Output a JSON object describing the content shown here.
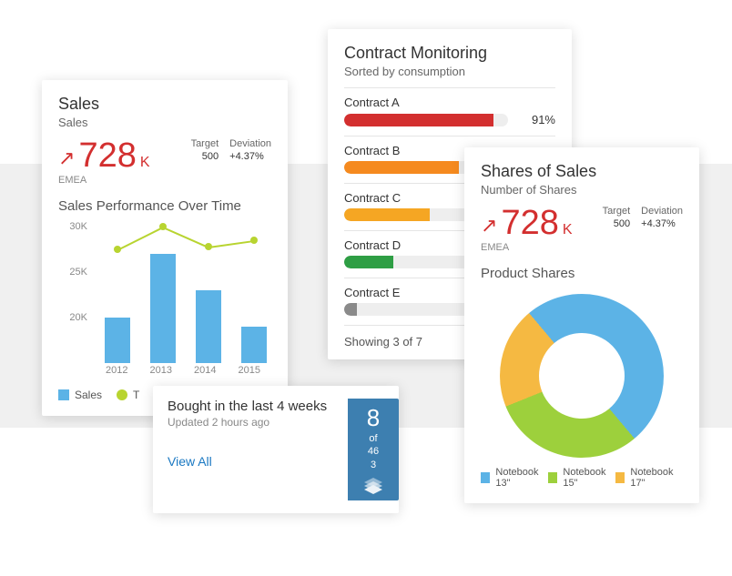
{
  "sales": {
    "title": "Sales",
    "subtitle": "Sales",
    "kpi": {
      "arrow": "↗",
      "value": "728",
      "unit": "K"
    },
    "target_label": "Target",
    "deviation_label": "Deviation",
    "target_value": "500",
    "deviation_value": "+4.37%",
    "region": "EMEA",
    "section": "Sales Performance Over Time",
    "legend_sales": "Sales",
    "legend_target": "T"
  },
  "contracts": {
    "title": "Contract Monitoring",
    "subtitle": "Sorted by consumption",
    "footer": "Showing 3 of 7",
    "items": [
      {
        "name": "Contract A",
        "pct": "91%",
        "fill": 91,
        "color": "#d32f2f"
      },
      {
        "name": "Contract B",
        "pct": "",
        "fill": 70,
        "color": "#f58a1f"
      },
      {
        "name": "Contract C",
        "pct": "",
        "fill": 52,
        "color": "#f5a623"
      },
      {
        "name": "Contract D",
        "pct": "",
        "fill": 30,
        "color": "#2e9e44"
      },
      {
        "name": "Contract E",
        "pct": "",
        "fill": 8,
        "color": "#8a8a8a"
      }
    ]
  },
  "shares": {
    "title": "Shares of Sales",
    "subtitle": "Number of Shares",
    "kpi": {
      "arrow": "↗",
      "value": "728",
      "unit": "K"
    },
    "target_label": "Target",
    "deviation_label": "Deviation",
    "target_value": "500",
    "deviation_value": "+4.37%",
    "region": "EMEA",
    "section": "Product Shares",
    "legend": [
      "Notebook 13\"",
      "Notebook 15\"",
      "Notebook 17\""
    ]
  },
  "bought": {
    "title": "Bought in the last 4 weeks",
    "subtitle": "Updated 2 hours ago",
    "view_all": "View All",
    "count_big": "8",
    "count_of": "of",
    "count_total": "46",
    "count_extra": "3"
  },
  "chart_data": [
    {
      "type": "bar",
      "title": "Sales Performance Over Time",
      "categories": [
        "2012",
        "2013",
        "2014",
        "2015"
      ],
      "series": [
        {
          "name": "Sales",
          "values": [
            20000,
            27000,
            23000,
            19000
          ]
        },
        {
          "name": "Target",
          "values": [
            27500,
            30000,
            27800,
            28500
          ]
        }
      ],
      "ylim": [
        15000,
        30000
      ],
      "ylabel": "",
      "xlabel": ""
    },
    {
      "type": "pie",
      "title": "Product Shares",
      "categories": [
        "Notebook 13\"",
        "Notebook 15\"",
        "Notebook 17\""
      ],
      "values": [
        50,
        30,
        20
      ],
      "colors": [
        "#5cb3e6",
        "#9dd03c",
        "#f5b942"
      ]
    },
    {
      "type": "bar",
      "title": "Contract Monitoring — Sorted by consumption",
      "categories": [
        "Contract A",
        "Contract B",
        "Contract C",
        "Contract D",
        "Contract E"
      ],
      "values": [
        91,
        70,
        52,
        30,
        8
      ],
      "xlim": [
        0,
        100
      ]
    }
  ]
}
